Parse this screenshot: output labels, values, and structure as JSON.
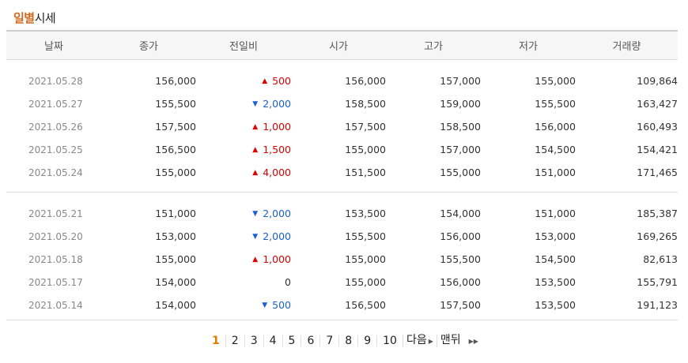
{
  "title": {
    "accent": "일별",
    "rest": "시세"
  },
  "headers": [
    "날짜",
    "종가",
    "전일비",
    "시가",
    "고가",
    "저가",
    "거래량"
  ],
  "groups": [
    [
      {
        "date": "2021.05.28",
        "close": "156,000",
        "dir": "up",
        "change": "500",
        "open": "156,000",
        "high": "157,000",
        "low": "155,000",
        "volume": "109,864"
      },
      {
        "date": "2021.05.27",
        "close": "155,500",
        "dir": "down",
        "change": "2,000",
        "open": "158,500",
        "high": "159,000",
        "low": "155,500",
        "volume": "163,427"
      },
      {
        "date": "2021.05.26",
        "close": "157,500",
        "dir": "up",
        "change": "1,000",
        "open": "157,500",
        "high": "158,500",
        "low": "156,000",
        "volume": "160,493"
      },
      {
        "date": "2021.05.25",
        "close": "156,500",
        "dir": "up",
        "change": "1,500",
        "open": "155,000",
        "high": "157,000",
        "low": "154,500",
        "volume": "154,421"
      },
      {
        "date": "2021.05.24",
        "close": "155,000",
        "dir": "up",
        "change": "4,000",
        "open": "151,500",
        "high": "155,000",
        "low": "151,000",
        "volume": "171,465"
      }
    ],
    [
      {
        "date": "2021.05.21",
        "close": "151,000",
        "dir": "down",
        "change": "2,000",
        "open": "153,500",
        "high": "154,000",
        "low": "151,000",
        "volume": "185,387"
      },
      {
        "date": "2021.05.20",
        "close": "153,000",
        "dir": "down",
        "change": "2,000",
        "open": "155,500",
        "high": "156,000",
        "low": "153,000",
        "volume": "169,265"
      },
      {
        "date": "2021.05.18",
        "close": "155,000",
        "dir": "up",
        "change": "1,000",
        "open": "155,000",
        "high": "155,500",
        "low": "154,500",
        "volume": "82,613"
      },
      {
        "date": "2021.05.17",
        "close": "154,000",
        "dir": "flat",
        "change": "0",
        "open": "155,000",
        "high": "156,000",
        "low": "153,500",
        "volume": "155,791"
      },
      {
        "date": "2021.05.14",
        "close": "154,000",
        "dir": "down",
        "change": "500",
        "open": "156,500",
        "high": "157,500",
        "low": "153,500",
        "volume": "191,123"
      }
    ]
  ],
  "pagination": {
    "pages": [
      "1",
      "2",
      "3",
      "4",
      "5",
      "6",
      "7",
      "8",
      "9",
      "10"
    ],
    "active": "1",
    "next_label": "다음",
    "last_label": "맨뒤"
  },
  "colors": {
    "up": "#dd0000",
    "down": "#1a60d0",
    "accent": "#d2691e"
  },
  "icons": {
    "up": "triangle-up-icon",
    "down": "triangle-down-icon",
    "next": "triangle-right-icon",
    "last": "double-triangle-right-icon"
  }
}
